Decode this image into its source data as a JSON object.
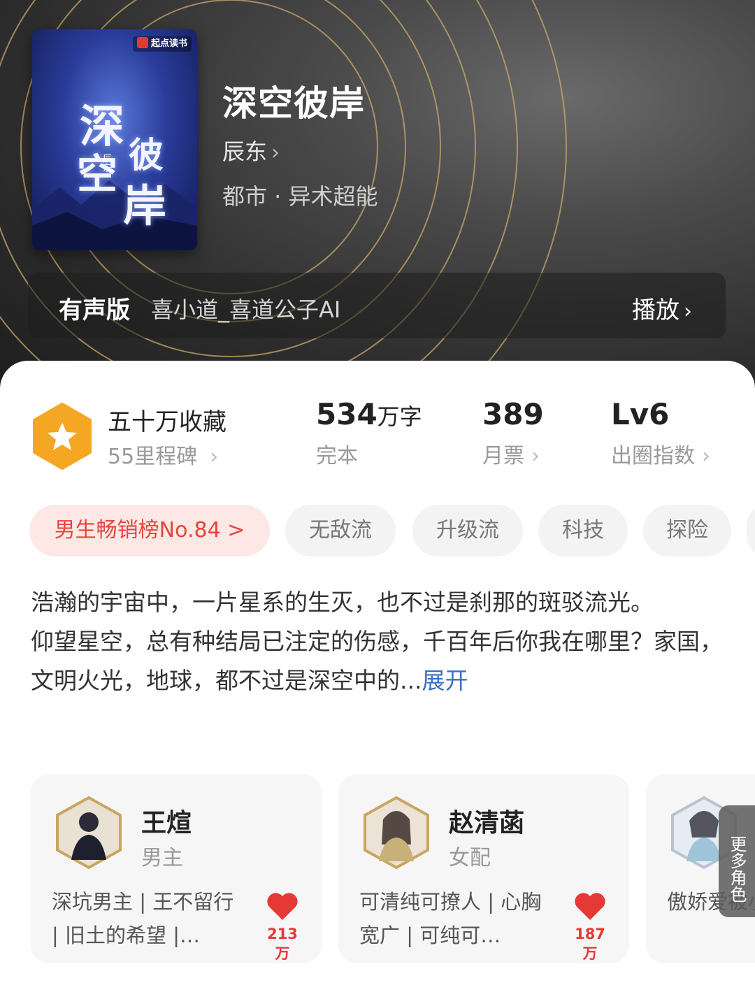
{
  "book": {
    "cover_badge": "起点读书",
    "cover_chars": [
      "深",
      "空",
      "彼",
      "岸"
    ],
    "cover_author_mark": "辰东",
    "title": "深空彼岸",
    "author": "辰东",
    "genre": "都市 · 异术超能"
  },
  "audio": {
    "label": "有声版",
    "narrator": "喜小道_喜道公子AI",
    "play_label": "播放"
  },
  "stats": {
    "favorites_title": "五十万收藏",
    "favorites_sub": "55里程碑",
    "word_count_value": "534",
    "word_count_unit": "万字",
    "status": "完本",
    "monthly_votes_value": "389",
    "monthly_votes_label": "月票",
    "level_value": "Lv6",
    "level_label": "出圈指数"
  },
  "tags": {
    "rank": "男生畅销榜No.84 >",
    "items": [
      "无敌流",
      "升级流",
      "科技",
      "探险"
    ]
  },
  "description": {
    "text": "浩瀚的宇宙中，一片星系的生灭，也不过是刹那的斑驳流光。\n仰望星空，总有种结局已注定的伤感，千百年后你我在哪里？家国，文明火光，地球，都不过是深空中的...",
    "expand_label": "展开"
  },
  "characters": [
    {
      "name": "王煊",
      "role": "男主",
      "tagline": "深坑男主 | 王不留行 | 旧土的希望 |…",
      "likes": "213万"
    },
    {
      "name": "赵清菡",
      "role": "女配",
      "tagline": "可清纯可撩人 | 心胸宽广 | 可纯可…",
      "likes": "187万"
    },
    {
      "name": "",
      "role": "",
      "tagline": "傲娇爱被小姐姐 |",
      "likes": ""
    }
  ],
  "more_characters_label": "更多角色",
  "colors": {
    "accent_red": "#e5453b",
    "link_blue": "#3a6fc2",
    "favorite_badge": "#f5a623"
  }
}
